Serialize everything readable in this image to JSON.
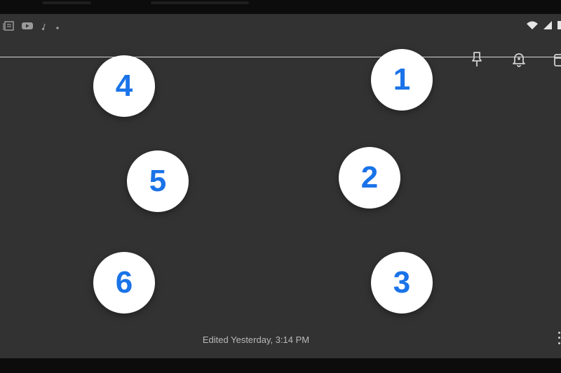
{
  "status_bar": {
    "left_icons": [
      "notes-icon",
      "youtube-icon",
      "music-icon",
      "dot-icon"
    ],
    "right_icons": [
      "wifi-icon",
      "signal-icon",
      "battery-icon"
    ]
  },
  "toolbar": {
    "icons": [
      "pin-icon",
      "bell-reminder-icon",
      "archive-icon"
    ]
  },
  "numbered_targets": [
    {
      "label": "1"
    },
    {
      "label": "2"
    },
    {
      "label": "3"
    },
    {
      "label": "4"
    },
    {
      "label": "5"
    },
    {
      "label": "6"
    }
  ],
  "footer": {
    "edited_text": "Edited Yesterday, 3:14 PM"
  },
  "colors": {
    "background": "#323233",
    "circle_fill": "#ffffff",
    "number_color": "#1a73e8",
    "divider": "#d8d8d8"
  }
}
